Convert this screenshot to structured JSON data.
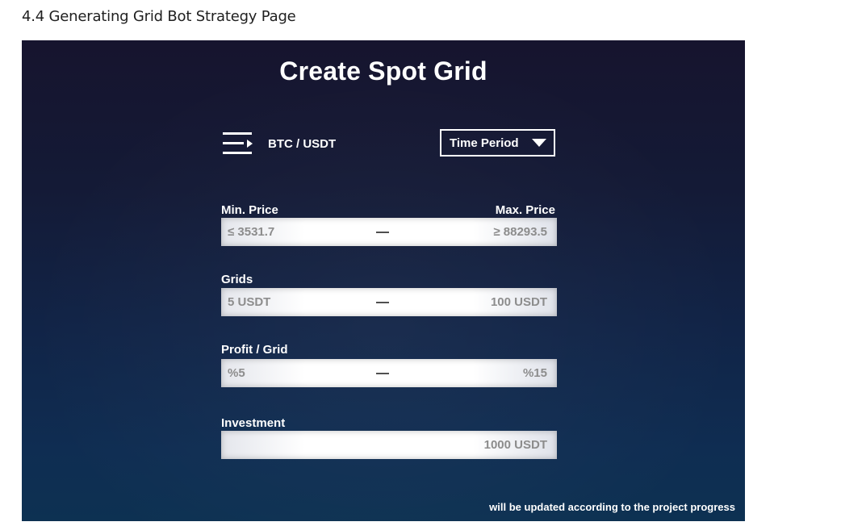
{
  "doc_heading": "4.4 Generating Grid Bot Strategy Page",
  "screen": {
    "title": "Create Spot Grid",
    "pair": {
      "icon": "list-arrow-icon",
      "label": "BTC / USDT"
    },
    "period_dropdown": {
      "label": "Time Period",
      "icon": "caret-down-icon"
    },
    "price": {
      "min_label": "Min. Price",
      "max_label": "Max. Price",
      "min_value": "≤ 3531.7",
      "max_value": "≥ 88293.5"
    },
    "grids": {
      "label": "Grids",
      "min_value": "5 USDT",
      "max_value": "100 USDT"
    },
    "profit": {
      "label": "Profit / Grid",
      "min_value": "%5",
      "max_value": "%15"
    },
    "investment": {
      "label": "Investment",
      "value": "1000 USDT"
    },
    "footnote": "will be updated according to the project progress"
  }
}
